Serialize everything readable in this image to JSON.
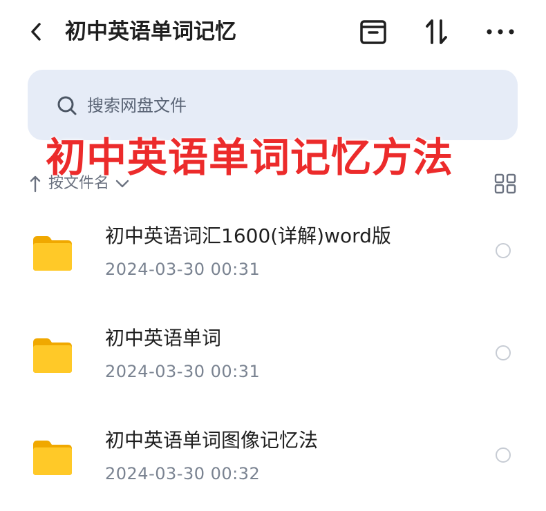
{
  "header": {
    "title": "初中英语单词记忆",
    "back_icon": "chevron-left-icon",
    "actions": [
      {
        "icon": "archive-box-icon"
      },
      {
        "icon": "sort-arrows-icon"
      },
      {
        "icon": "more-horizontal-icon"
      }
    ]
  },
  "search": {
    "placeholder": "搜索网盘文件",
    "icon": "search-icon"
  },
  "overlay": {
    "text": "初中英语单词记忆方法",
    "color": "#ec2b2b"
  },
  "sort": {
    "label": "按文件名",
    "direction": "ascending",
    "view_toggle_icon": "grid-view-icon"
  },
  "files": [
    {
      "name": "初中英语词汇1600(详解)word版",
      "date": "2024-03-30  00:31",
      "icon": "folder-icon",
      "selected": false
    },
    {
      "name": "初中英语单词",
      "date": "2024-03-30  00:31",
      "icon": "folder-icon",
      "selected": false
    },
    {
      "name": "初中英语单词图像记忆法",
      "date": "2024-03-30  00:32",
      "icon": "folder-icon",
      "selected": false
    }
  ],
  "colors": {
    "search_bg": "#e6ecf7",
    "folder": "#f7c21a",
    "accent_text": "#1f1f1f",
    "meta_text": "#7a8391"
  }
}
